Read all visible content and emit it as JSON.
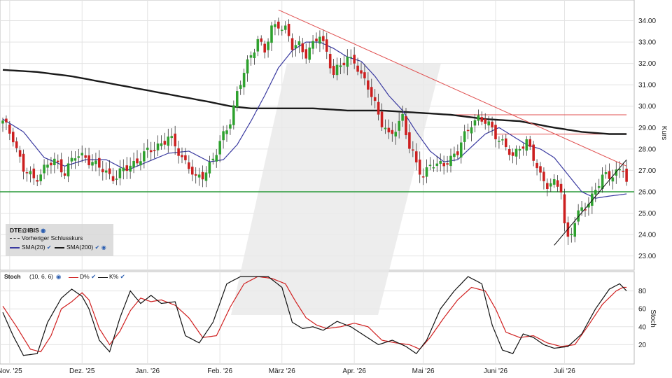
{
  "chart_data": [
    {
      "type": "candlestick",
      "ticker": "DTE@IBIS",
      "ylabel": "Kurs",
      "ylim": [
        22.4,
        34.9
      ],
      "yticks": [
        23,
        24,
        25,
        26,
        27,
        28,
        29,
        30,
        31,
        32,
        33,
        34
      ],
      "ytick_labels": [
        "23.00",
        "24.00",
        "25.00",
        "26.00",
        "27.00",
        "28.00",
        "29.00",
        "30.00",
        "31.00",
        "32.00",
        "33.00",
        "34.00"
      ],
      "xlim": [
        0,
        177
      ],
      "xticks": [
        {
          "label": "Nov. '25",
          "x": 2
        },
        {
          "label": "Dez. '25",
          "x": 23
        },
        {
          "label": "Jan. '26",
          "x": 42
        },
        {
          "label": "Feb. '26",
          "x": 63
        },
        {
          "label": "März '26",
          "x": 81
        },
        {
          "label": "Apr. '26",
          "x": 102
        },
        {
          "label": "Mai '26",
          "x": 122
        },
        {
          "label": "Juni '26",
          "x": 143
        },
        {
          "label": "Juli '26",
          "x": 163
        }
      ],
      "legend": {
        "ticker": "DTE@IBIS",
        "prev_close": "Vorheriger Schlusskurs",
        "sma20": "SMA(20)",
        "sma200": "SMA(200)"
      },
      "colors": {
        "up": "#2ea12e",
        "down": "#cc1f1f",
        "sma20": "#3a3aa0",
        "sma200": "#1a1a1a",
        "support": "#2a9a3a",
        "trend": "#e05050",
        "watermark": "#e6e6e6"
      },
      "ohlc_anchors": [
        [
          0,
          29.2
        ],
        [
          3,
          28.6
        ],
        [
          6,
          27.0
        ],
        [
          9,
          26.6
        ],
        [
          12,
          27.1
        ],
        [
          15,
          27.4
        ],
        [
          18,
          27.0
        ],
        [
          21,
          27.6
        ],
        [
          24,
          27.7
        ],
        [
          27,
          27.2
        ],
        [
          30,
          26.9
        ],
        [
          33,
          26.7
        ],
        [
          36,
          27.1
        ],
        [
          39,
          27.5
        ],
        [
          42,
          27.8
        ],
        [
          45,
          28.2
        ],
        [
          48,
          28.5
        ],
        [
          51,
          27.9
        ],
        [
          54,
          27.2
        ],
        [
          56,
          26.5
        ],
        [
          58,
          26.8
        ],
        [
          60,
          27.3
        ],
        [
          62,
          27.8
        ],
        [
          64,
          28.6
        ],
        [
          66,
          29.4
        ],
        [
          68,
          30.6
        ],
        [
          70,
          31.5
        ],
        [
          72,
          32.4
        ],
        [
          74,
          33.2
        ],
        [
          76,
          32.5
        ],
        [
          78,
          33.6
        ],
        [
          80,
          33.9
        ],
        [
          82,
          33.6
        ],
        [
          84,
          32.7
        ],
        [
          86,
          32.9
        ],
        [
          88,
          32.5
        ],
        [
          90,
          32.8
        ],
        [
          92,
          33.3
        ],
        [
          94,
          32.6
        ],
        [
          96,
          31.5
        ],
        [
          98,
          31.8
        ],
        [
          100,
          32.3
        ],
        [
          102,
          32.2
        ],
        [
          104,
          31.3
        ],
        [
          106,
          30.9
        ],
        [
          108,
          30.2
        ],
        [
          110,
          29.2
        ],
        [
          112,
          28.5
        ],
        [
          114,
          29.0
        ],
        [
          116,
          29.6
        ],
        [
          118,
          28.0
        ],
        [
          120,
          27.3
        ],
        [
          122,
          26.8
        ],
        [
          124,
          27.3
        ],
        [
          126,
          27.1
        ],
        [
          128,
          27.4
        ],
        [
          130,
          27.6
        ],
        [
          132,
          27.8
        ],
        [
          134,
          28.6
        ],
        [
          136,
          29.3
        ],
        [
          138,
          29.4
        ],
        [
          140,
          29.2
        ],
        [
          142,
          29.0
        ],
        [
          144,
          28.5
        ],
        [
          146,
          28.0
        ],
        [
          148,
          27.6
        ],
        [
          150,
          28.2
        ],
        [
          152,
          28.3
        ],
        [
          154,
          27.5
        ],
        [
          156,
          26.8
        ],
        [
          158,
          26.4
        ],
        [
          160,
          26.3
        ],
        [
          162,
          26.1
        ],
        [
          163,
          24.5
        ],
        [
          164,
          23.9
        ],
        [
          166,
          24.6
        ],
        [
          168,
          25.1
        ],
        [
          170,
          25.5
        ],
        [
          172,
          26.2
        ],
        [
          174,
          26.6
        ],
        [
          176,
          26.7
        ],
        [
          178,
          27.0
        ],
        [
          180,
          27.1
        ],
        [
          181,
          26.4
        ]
      ],
      "sma20": [
        [
          0,
          29.4
        ],
        [
          6,
          28.8
        ],
        [
          12,
          27.6
        ],
        [
          18,
          27.2
        ],
        [
          24,
          27.5
        ],
        [
          30,
          27.5
        ],
        [
          36,
          27.0
        ],
        [
          42,
          27.4
        ],
        [
          48,
          27.8
        ],
        [
          54,
          27.9
        ],
        [
          60,
          27.4
        ],
        [
          64,
          27.5
        ],
        [
          68,
          28.2
        ],
        [
          72,
          29.3
        ],
        [
          76,
          30.5
        ],
        [
          80,
          31.8
        ],
        [
          84,
          32.6
        ],
        [
          88,
          33.0
        ],
        [
          92,
          33.0
        ],
        [
          96,
          32.7
        ],
        [
          100,
          32.3
        ],
        [
          104,
          32.1
        ],
        [
          108,
          31.4
        ],
        [
          112,
          30.5
        ],
        [
          116,
          29.8
        ],
        [
          120,
          28.8
        ],
        [
          124,
          27.9
        ],
        [
          128,
          27.4
        ],
        [
          132,
          27.5
        ],
        [
          136,
          28.1
        ],
        [
          140,
          28.7
        ],
        [
          144,
          29.0
        ],
        [
          148,
          28.6
        ],
        [
          152,
          28.2
        ],
        [
          156,
          28.0
        ],
        [
          160,
          27.6
        ],
        [
          164,
          26.8
        ],
        [
          168,
          26.0
        ],
        [
          172,
          25.7
        ],
        [
          176,
          25.8
        ],
        [
          181,
          25.9
        ]
      ],
      "sma200": [
        [
          0,
          31.7
        ],
        [
          10,
          31.6
        ],
        [
          20,
          31.4
        ],
        [
          30,
          31.1
        ],
        [
          40,
          30.8
        ],
        [
          50,
          30.5
        ],
        [
          60,
          30.2
        ],
        [
          66,
          30.0
        ],
        [
          72,
          29.9
        ],
        [
          80,
          29.9
        ],
        [
          90,
          29.9
        ],
        [
          100,
          29.8
        ],
        [
          110,
          29.8
        ],
        [
          120,
          29.7
        ],
        [
          130,
          29.6
        ],
        [
          140,
          29.4
        ],
        [
          150,
          29.3
        ],
        [
          160,
          29.0
        ],
        [
          168,
          28.8
        ],
        [
          176,
          28.7
        ],
        [
          181,
          28.7
        ]
      ],
      "support_level": 26.0,
      "resistance_levels": [
        {
          "y": 29.6,
          "x0": 130,
          "x1": 181
        },
        {
          "y": 28.7,
          "x0": 143,
          "x1": 181
        }
      ],
      "trendlines": [
        {
          "x0": 80,
          "y0": 34.5,
          "x1": 181,
          "y1": 27.2
        },
        {
          "x0": 160,
          "y0": 23.5,
          "x1": 181,
          "y1": 27.5
        }
      ]
    },
    {
      "type": "line",
      "indicator": "Stoch",
      "params": "(10, 6, 6)",
      "ylabel": "Stoch",
      "ylim": [
        0,
        100
      ],
      "yticks": [
        20,
        40,
        60,
        80
      ],
      "ytick_labels": [
        "20",
        "40",
        "60",
        "80"
      ],
      "series": [
        {
          "name": "D%",
          "color": "#d02020",
          "points": [
            [
              0,
              63
            ],
            [
              4,
              40
            ],
            [
              8,
              15
            ],
            [
              11,
              12
            ],
            [
              14,
              30
            ],
            [
              17,
              60
            ],
            [
              20,
              68
            ],
            [
              23,
              78
            ],
            [
              25,
              70
            ],
            [
              28,
              38
            ],
            [
              31,
              20
            ],
            [
              34,
              35
            ],
            [
              37,
              58
            ],
            [
              40,
              72
            ],
            [
              43,
              68
            ],
            [
              46,
              70
            ],
            [
              50,
              64
            ],
            [
              54,
              50
            ],
            [
              58,
              28
            ],
            [
              62,
              30
            ],
            [
              66,
              62
            ],
            [
              70,
              88
            ],
            [
              74,
              96
            ],
            [
              78,
              94
            ],
            [
              82,
              88
            ],
            [
              85,
              68
            ],
            [
              88,
              50
            ],
            [
              91,
              42
            ],
            [
              94,
              38
            ],
            [
              98,
              40
            ],
            [
              102,
              44
            ],
            [
              106,
              40
            ],
            [
              110,
              25
            ],
            [
              114,
              22
            ],
            [
              118,
              20
            ],
            [
              121,
              15
            ],
            [
              124,
              28
            ],
            [
              128,
              50
            ],
            [
              132,
              70
            ],
            [
              136,
              84
            ],
            [
              140,
              80
            ],
            [
              143,
              60
            ],
            [
              146,
              34
            ],
            [
              150,
              28
            ],
            [
              154,
              30
            ],
            [
              158,
              22
            ],
            [
              162,
              18
            ],
            [
              166,
              20
            ],
            [
              170,
              42
            ],
            [
              174,
              65
            ],
            [
              178,
              80
            ],
            [
              180,
              84
            ],
            [
              181,
              84
            ]
          ]
        },
        {
          "name": "K%",
          "color": "#111111",
          "points": [
            [
              0,
              56
            ],
            [
              3,
              30
            ],
            [
              6,
              8
            ],
            [
              10,
              10
            ],
            [
              13,
              45
            ],
            [
              17,
              72
            ],
            [
              20,
              82
            ],
            [
              23,
              74
            ],
            [
              25,
              60
            ],
            [
              28,
              25
            ],
            [
              31,
              12
            ],
            [
              34,
              50
            ],
            [
              37,
              80
            ],
            [
              40,
              66
            ],
            [
              43,
              75
            ],
            [
              46,
              66
            ],
            [
              50,
              68
            ],
            [
              53,
              30
            ],
            [
              57,
              22
            ],
            [
              61,
              45
            ],
            [
              65,
              88
            ],
            [
              69,
              96
            ],
            [
              73,
              96
            ],
            [
              77,
              96
            ],
            [
              81,
              84
            ],
            [
              84,
              45
            ],
            [
              87,
              38
            ],
            [
              90,
              40
            ],
            [
              93,
              36
            ],
            [
              97,
              46
            ],
            [
              101,
              40
            ],
            [
              105,
              30
            ],
            [
              109,
              20
            ],
            [
              113,
              25
            ],
            [
              117,
              18
            ],
            [
              120,
              10
            ],
            [
              123,
              25
            ],
            [
              127,
              60
            ],
            [
              131,
              80
            ],
            [
              135,
              96
            ],
            [
              139,
              88
            ],
            [
              142,
              42
            ],
            [
              145,
              14
            ],
            [
              148,
              10
            ],
            [
              151,
              32
            ],
            [
              154,
              28
            ],
            [
              157,
              20
            ],
            [
              160,
              16
            ],
            [
              164,
              18
            ],
            [
              168,
              32
            ],
            [
              172,
              60
            ],
            [
              176,
              82
            ],
            [
              179,
              88
            ],
            [
              181,
              80
            ]
          ]
        }
      ]
    }
  ]
}
